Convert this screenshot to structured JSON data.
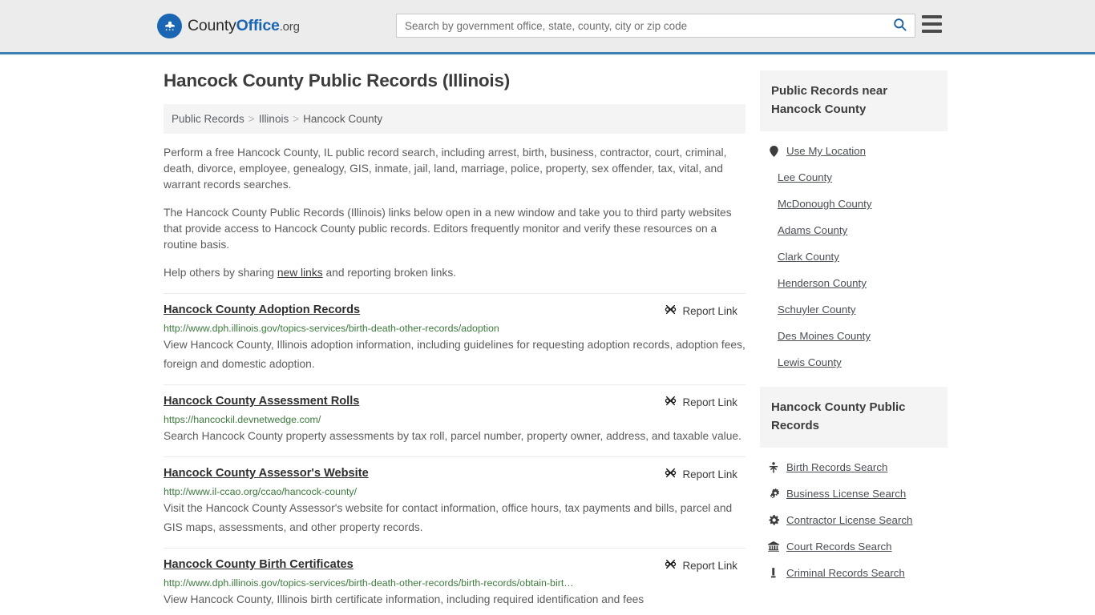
{
  "header": {
    "logo": {
      "icon": "eagle-seal-icon",
      "text_county": "County",
      "text_office": "Office",
      "text_org": ".org"
    },
    "search": {
      "placeholder": "Search by government office, state, county, city or zip code",
      "value": "",
      "button_icon": "search-icon"
    },
    "menu_icon": "hamburger-menu-icon"
  },
  "main": {
    "title": "Hancock County Public Records (Illinois)",
    "breadcrumb": {
      "item1": "Public Records",
      "sep1": ">",
      "item2": "Illinois",
      "sep2": ">",
      "item3": "Hancock County"
    },
    "intro": {
      "p1": "Perform a free Hancock County, IL public record search, including arrest, birth, business, contractor, court, criminal, death, divorce, employee, genealogy, GIS, inmate, jail, land, marriage, police, property, sex offender, tax, vital, and warrant records searches.",
      "p2": "The Hancock County Public Records (Illinois) links below open in a new window and take you to third party websites that provide access to Hancock County public records. Editors frequently monitor and verify these resources on a routine basis.",
      "p3_before": "Help others by sharing ",
      "p3_link": "new links",
      "p3_after": " and reporting broken links."
    },
    "report_link_label": "Report Link",
    "report_link_icon": "broken-link-icon",
    "results": [
      {
        "title": "Hancock County Adoption Records",
        "url": "http://www.dph.illinois.gov/topics-services/birth-death-other-records/adoption",
        "description": "View Hancock County, Illinois adoption information, including guidelines for requesting adoption records, adoption fees, foreign and domestic adoption."
      },
      {
        "title": "Hancock County Assessment Rolls",
        "url": "https://hancockil.devnetwedge.com/",
        "description": "Search Hancock County property assessments by tax roll, parcel number, property owner, address, and taxable value."
      },
      {
        "title": "Hancock County Assessor's Website",
        "url": "http://www.il-ccao.org/ccao/hancock-county/",
        "description": "Visit the Hancock County Assessor's website for contact information, office hours, tax payments and bills, parcel and GIS maps, assessments, and other property records."
      },
      {
        "title": "Hancock County Birth Certificates",
        "url": "http://www.dph.illinois.gov/topics-services/birth-death-other-records/birth-records/obtain-birt…",
        "description": "View Hancock County, Illinois birth certificate information, including required identification and fees"
      }
    ]
  },
  "sidebar": {
    "nearby": {
      "heading": "Public Records near Hancock County",
      "items": [
        {
          "label": "Use My Location",
          "icon": "map-pin-icon"
        },
        {
          "label": "Lee County",
          "icon": ""
        },
        {
          "label": "McDonough County",
          "icon": ""
        },
        {
          "label": "Adams County",
          "icon": ""
        },
        {
          "label": "Clark County",
          "icon": ""
        },
        {
          "label": "Henderson County",
          "icon": ""
        },
        {
          "label": "Schuyler County",
          "icon": ""
        },
        {
          "label": "Des Moines County",
          "icon": ""
        },
        {
          "label": "Lewis County",
          "icon": ""
        }
      ]
    },
    "records": {
      "heading": "Hancock County Public Records",
      "items": [
        {
          "label": "Birth Records Search",
          "icon": "child-icon"
        },
        {
          "label": "Business License Search",
          "icon": "double-gear-icon"
        },
        {
          "label": "Contractor License Search",
          "icon": "gear-icon"
        },
        {
          "label": "Court Records Search",
          "icon": "courthouse-icon"
        },
        {
          "label": "Criminal Records Search",
          "icon": "gavel-icon"
        }
      ]
    }
  },
  "colors": {
    "header_bg": "#ececec",
    "header_border": "#3c7fb1",
    "brand_blue": "#1b66b3",
    "url_green": "#3d7a3d",
    "panel_bg": "#f4f4f4"
  }
}
